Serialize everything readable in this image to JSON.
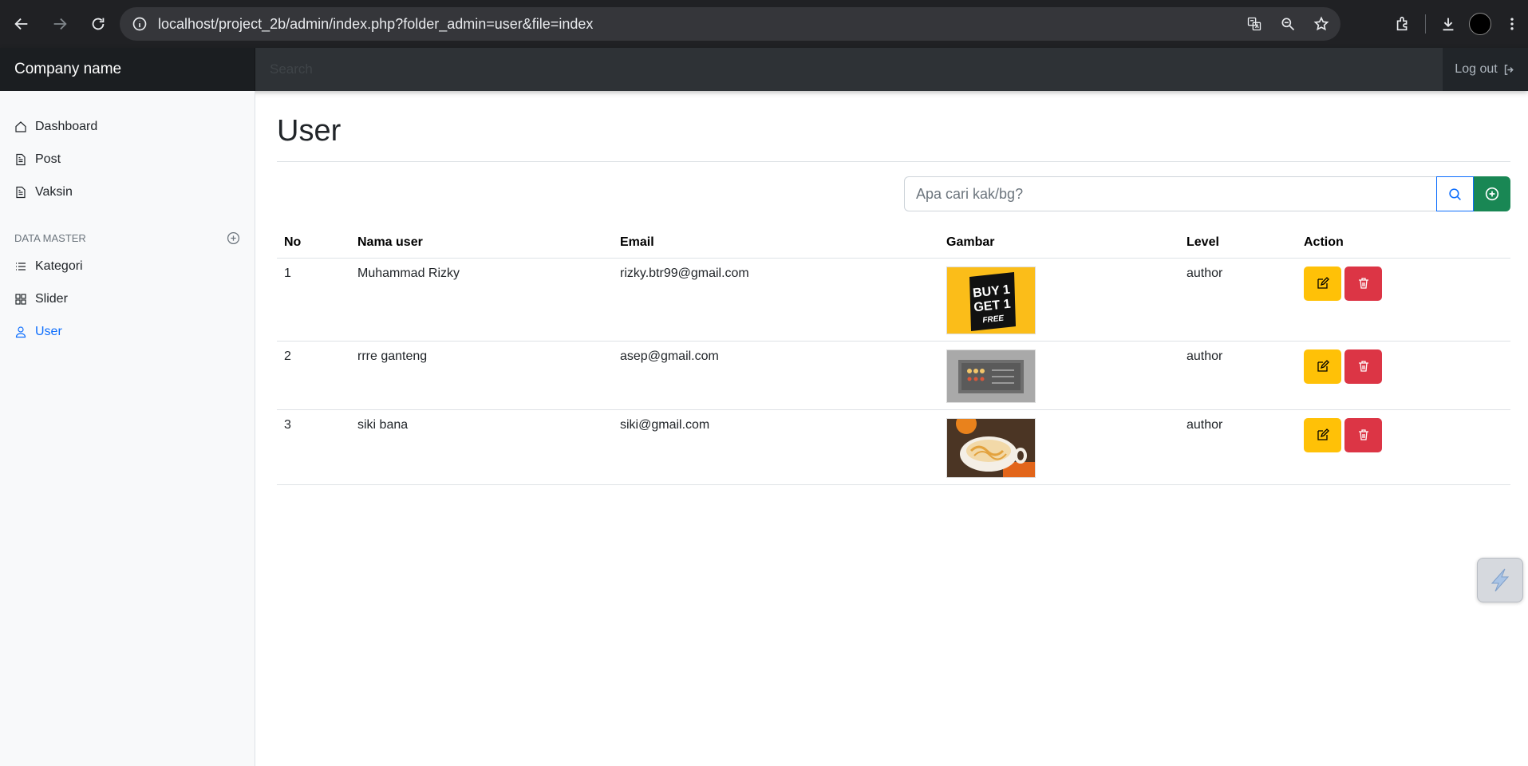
{
  "browser": {
    "url": "localhost/project_2b/admin/index.php?folder_admin=user&file=index"
  },
  "navbar": {
    "brand": "Company name",
    "search_placeholder": "Search",
    "logout_label": "Log out"
  },
  "sidebar": {
    "items": [
      {
        "label": "Dashboard",
        "icon": "house-icon"
      },
      {
        "label": "Post",
        "icon": "file-icon"
      },
      {
        "label": "Vaksin",
        "icon": "file-icon"
      }
    ],
    "master_heading": "DATA MASTER",
    "master_items": [
      {
        "label": "Kategori",
        "icon": "list-icon"
      },
      {
        "label": "Slider",
        "icon": "grid-icon"
      },
      {
        "label": "User",
        "icon": "person-icon",
        "active": true
      }
    ]
  },
  "main": {
    "title": "User",
    "search_placeholder": "Apa cari kak/bg?",
    "table": {
      "headers": [
        "No",
        "Nama user",
        "Email",
        "Gambar",
        "Level",
        "Action"
      ],
      "rows": [
        {
          "no": "1",
          "name": "Muhammad Rizky",
          "email": "rizky.btr99@gmail.com",
          "level": "author",
          "image": "buy-1-get-1-free-banner",
          "image_text": [
            "BUY 1",
            "GET 1",
            "FREE"
          ]
        },
        {
          "no": "2",
          "name": "rrre ganteng",
          "email": "asep@gmail.com",
          "level": "author",
          "image": "gray-device-panel-photo"
        },
        {
          "no": "3",
          "name": "siki bana",
          "email": "siki@gmail.com",
          "level": "author",
          "image": "coffee-cup-photo"
        }
      ]
    }
  },
  "colors": {
    "navbar_bg": "#212529",
    "sidebar_bg": "#f8f9fa",
    "active_link": "#0d6efd",
    "edit_btn": "#ffc107",
    "delete_btn": "#dc3545",
    "add_btn": "#198754"
  }
}
